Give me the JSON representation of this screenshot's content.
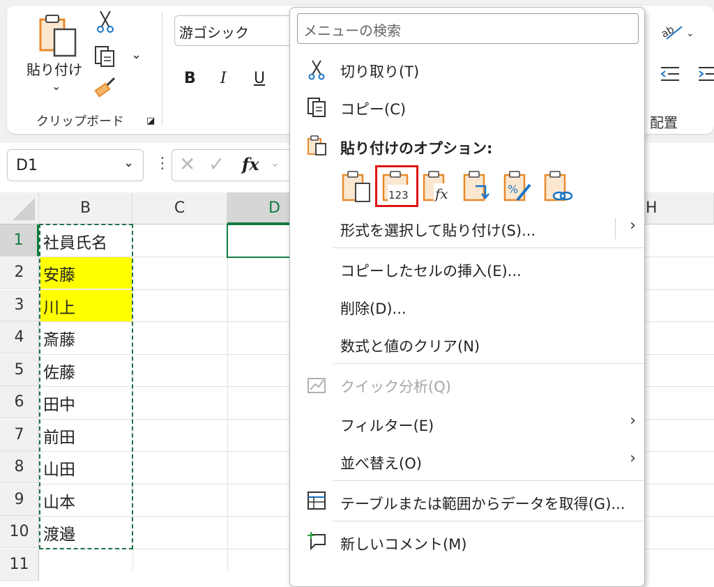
{
  "ribbon": {
    "paste_label": "貼り付け",
    "clipboard_group": "クリップボード",
    "font_name": "游ゴシック",
    "bold": "B",
    "italic": "I",
    "underline": "U",
    "align_group": "配置"
  },
  "formula_bar": {
    "name_box": "D1",
    "fx": "fx"
  },
  "columns": [
    "B",
    "C",
    "D",
    "H"
  ],
  "rows": [
    "1",
    "2",
    "3",
    "4",
    "5",
    "6",
    "7",
    "8",
    "9",
    "10",
    "11"
  ],
  "cells": [
    "社員氏名",
    "安藤",
    "川上",
    "斎藤",
    "佐藤",
    "田中",
    "前田",
    "山田",
    "山本",
    "渡邉"
  ],
  "colors": {
    "highlight_fill": "#ffff00",
    "copy_border": "#1e7145",
    "selection_border": "#107c41",
    "paste_icon_orange": "#e8892b",
    "red_box": "#e01313"
  },
  "menu": {
    "search_placeholder": "メニューの検索",
    "cut": "切り取り(T)",
    "copy": "コピー(C)",
    "paste_options": "貼り付けのオプション:",
    "paste_special": "形式を選択して貼り付け(S)...",
    "insert_copied": "コピーしたセルの挿入(E)...",
    "delete": "削除(D)...",
    "clear": "数式と値のクリア(N)",
    "quick_analysis": "クイック分析(Q)",
    "filter": "フィルター(E)",
    "sort": "並べ替え(O)",
    "get_data": "テーブルまたは範囲からデータを取得(G)...",
    "new_comment": "新しいコメント(M)"
  },
  "paste_icons": [
    "paste-icon",
    "paste-values-icon",
    "paste-formulas-icon",
    "paste-transpose-icon",
    "paste-formatting-icon",
    "paste-link-icon"
  ],
  "paste_values_text": "123"
}
